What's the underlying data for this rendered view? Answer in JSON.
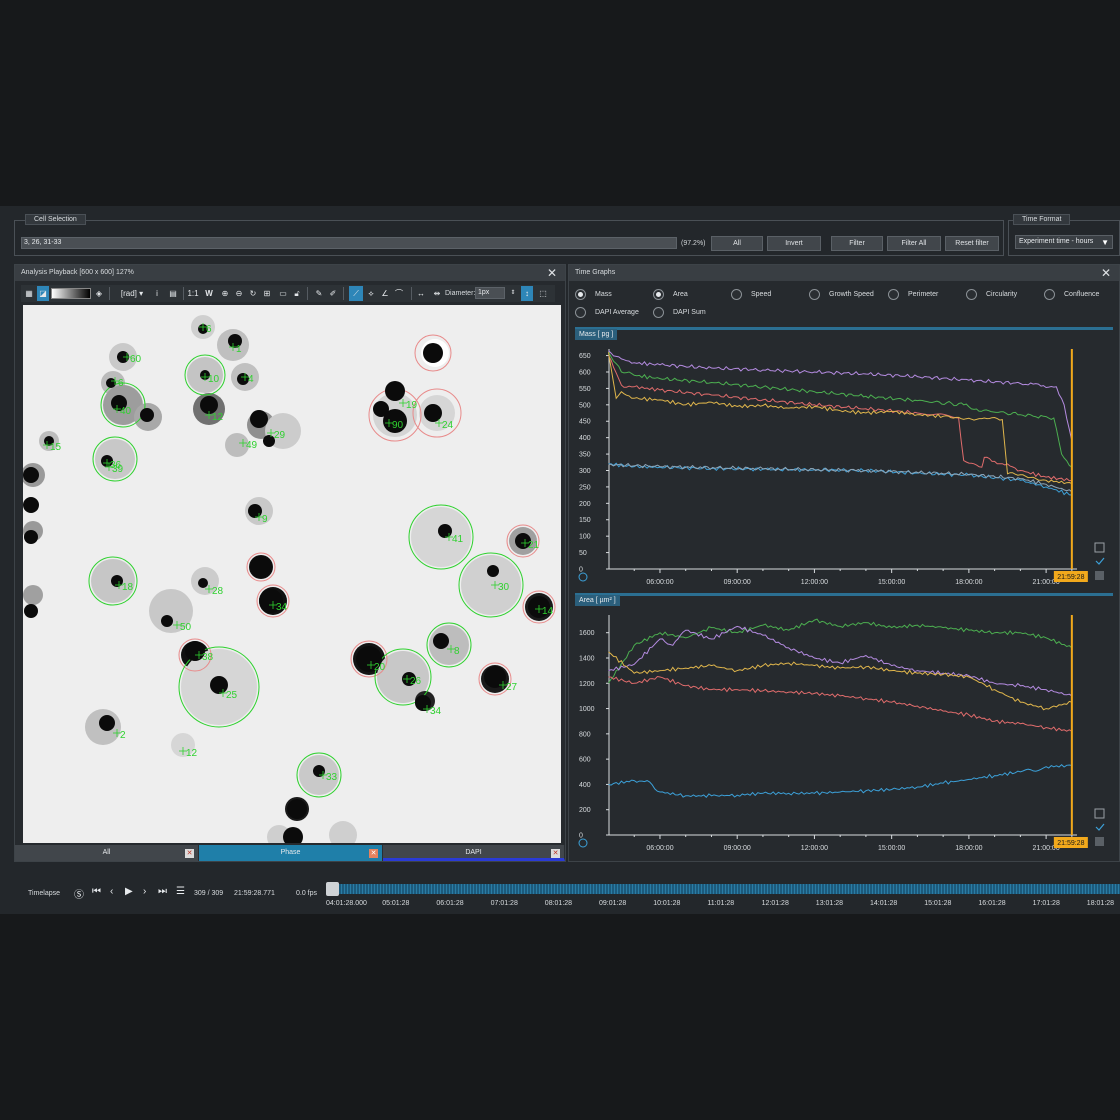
{
  "cell_selection": {
    "title": "Cell Selection",
    "value": "3, 26, 31-33",
    "percent": "(97.2%)",
    "buttons": [
      "All",
      "Invert",
      "Filter",
      "Filter All",
      "Reset filter"
    ]
  },
  "time_format": {
    "title": "Time Format",
    "selected": "Experiment time - hours"
  },
  "playback": {
    "title": "Analysis Playback [600 x 600] 127%",
    "toolbar": {
      "unit": "[rad]",
      "ratio": "1:1",
      "w": "W",
      "diameter_label": "Diameter:",
      "diameter_value": "1px"
    },
    "tabs": [
      "All",
      "Phase",
      "DAPI"
    ],
    "active_tab": "Phase",
    "cell_labels": [
      {
        "id": "6"
      },
      {
        "id": "1"
      },
      {
        "id": "60"
      },
      {
        "id": "6"
      },
      {
        "id": "10"
      },
      {
        "id": "4"
      },
      {
        "id": "40"
      },
      {
        "id": "29"
      },
      {
        "id": "12"
      },
      {
        "id": "19"
      },
      {
        "id": "90"
      },
      {
        "id": "24"
      },
      {
        "id": "39"
      },
      {
        "id": "49"
      },
      {
        "id": "15"
      },
      {
        "id": "36"
      },
      {
        "id": "9"
      },
      {
        "id": "41"
      },
      {
        "id": "21"
      },
      {
        "id": "30"
      },
      {
        "id": "28"
      },
      {
        "id": "18"
      },
      {
        "id": "34"
      },
      {
        "id": "14"
      },
      {
        "id": "50"
      },
      {
        "id": "38"
      },
      {
        "id": "20"
      },
      {
        "id": "26"
      },
      {
        "id": "8"
      },
      {
        "id": "27"
      },
      {
        "id": "25"
      },
      {
        "id": "34"
      },
      {
        "id": "2"
      },
      {
        "id": "12"
      },
      {
        "id": "33"
      }
    ]
  },
  "time_graphs": {
    "title": "Time Graphs",
    "measures": [
      {
        "label": "Mass",
        "selected": true
      },
      {
        "label": "Area",
        "selected": true
      },
      {
        "label": "Speed",
        "selected": false
      },
      {
        "label": "Growth Speed",
        "selected": false
      },
      {
        "label": "Perimeter",
        "selected": false
      },
      {
        "label": "Circularity",
        "selected": false
      },
      {
        "label": "Confluence",
        "selected": false
      },
      {
        "label": "DAPI Average",
        "selected": false
      },
      {
        "label": "DAPI Sum",
        "selected": false
      }
    ],
    "cursor_time": "21:59:28",
    "cursor_color": "#f2a91c"
  },
  "chart_data": [
    {
      "type": "line",
      "title": "Mass [ pg ]",
      "ylim": [
        0,
        670
      ],
      "y_ticks": [
        0,
        50,
        100,
        150,
        200,
        250,
        300,
        350,
        400,
        450,
        500,
        550,
        600,
        650
      ],
      "x_tick_labels": [
        "06:00:00",
        "09:00:00",
        "12:00:00",
        "15:00:00",
        "18:00:00",
        "21:00:00"
      ],
      "x_ticks_hours": [
        6,
        9,
        12,
        15,
        18,
        21
      ],
      "xlim_hours": [
        4.02,
        22.2
      ],
      "series": [
        {
          "color": "#b48be0",
          "x": [
            4.0,
            4.5,
            5,
            6,
            8,
            10,
            12,
            14,
            16,
            18,
            20,
            21.4,
            21.7,
            22.0
          ],
          "y": [
            665,
            640,
            628,
            622,
            612,
            606,
            600,
            594,
            586,
            575,
            565,
            555,
            500,
            390
          ]
        },
        {
          "color": "#4caf50",
          "x": [
            4.0,
            4.5,
            5,
            6,
            8,
            10,
            12,
            14,
            16,
            17.8,
            18.2,
            20,
            21.3,
            21.6,
            22.0
          ],
          "y": [
            660,
            600,
            590,
            580,
            568,
            554,
            540,
            526,
            513,
            500,
            486,
            470,
            460,
            350,
            310
          ]
        },
        {
          "color": "#e06c6c",
          "x": [
            4.0,
            4.5,
            5,
            6,
            8,
            10,
            12,
            14,
            16,
            17.6,
            17.8,
            18.5,
            18.6,
            20,
            21,
            22.0
          ],
          "y": [
            650,
            560,
            555,
            545,
            530,
            515,
            500,
            488,
            475,
            460,
            330,
            310,
            340,
            300,
            280,
            270
          ]
        },
        {
          "color": "#e0b64c",
          "x": [
            4.0,
            4.3,
            4.5,
            5,
            6,
            7,
            8,
            9,
            10,
            11,
            12,
            13,
            14,
            15,
            16,
            17,
            18.5,
            19.3,
            19.5,
            21,
            22.0
          ],
          "y": [
            660,
            520,
            540,
            520,
            515,
            500,
            508,
            495,
            498,
            490,
            495,
            482,
            475,
            480,
            470,
            465,
            458,
            455,
            290,
            270,
            260
          ]
        },
        {
          "color": "#3ca0d8",
          "x": [
            4.0,
            5,
            6,
            8,
            10,
            12,
            14,
            16,
            18,
            20,
            21,
            22.0
          ],
          "y": [
            320,
            312,
            310,
            306,
            304,
            302,
            300,
            292,
            286,
            270,
            250,
            225
          ]
        },
        {
          "color": "#8fa6b8",
          "x": [
            4.0,
            6,
            10,
            14,
            18,
            20,
            21,
            22.0
          ],
          "y": [
            318,
            312,
            305,
            300,
            288,
            275,
            258,
            235
          ]
        }
      ]
    },
    {
      "type": "line",
      "title": "Area [ µm² ]",
      "ylim": [
        0,
        1740
      ],
      "y_ticks": [
        0,
        200,
        400,
        600,
        800,
        1000,
        1200,
        1400,
        1600
      ],
      "x_tick_labels": [
        "06:00:00",
        "09:00:00",
        "12:00:00",
        "15:00:00",
        "18:00:00",
        "21:00:00"
      ],
      "x_ticks_hours": [
        6,
        9,
        12,
        15,
        18,
        21
      ],
      "xlim_hours": [
        4.02,
        22.2
      ],
      "series": [
        {
          "color": "#4caf50",
          "x": [
            4.0,
            5,
            6,
            7,
            8,
            9,
            10,
            11,
            12,
            13,
            14,
            15,
            16,
            17,
            18,
            19,
            20,
            21,
            22.0
          ],
          "y": [
            1200,
            1500,
            1600,
            1560,
            1640,
            1600,
            1660,
            1620,
            1700,
            1650,
            1680,
            1640,
            1660,
            1640,
            1620,
            1600,
            1600,
            1560,
            1480
          ]
        },
        {
          "color": "#b48be0",
          "x": [
            4.0,
            5,
            6,
            6.5,
            7,
            8,
            9,
            10,
            11,
            12,
            13,
            14,
            15,
            16,
            17,
            18,
            19,
            20,
            21,
            22.0
          ],
          "y": [
            1300,
            1350,
            1550,
            1500,
            1620,
            1550,
            1650,
            1580,
            1480,
            1400,
            1360,
            1420,
            1340,
            1300,
            1280,
            1260,
            1200,
            1180,
            1150,
            1100
          ]
        },
        {
          "color": "#e0b64c",
          "x": [
            4.0,
            5,
            6,
            7,
            8,
            9,
            10,
            11,
            12,
            13,
            14,
            15,
            16,
            17,
            18,
            19,
            20,
            21,
            22.0
          ],
          "y": [
            1450,
            1280,
            1300,
            1320,
            1340,
            1300,
            1340,
            1360,
            1340,
            1320,
            1330,
            1300,
            1280,
            1270,
            1250,
            1150,
            1050,
            1000,
            1050
          ]
        },
        {
          "color": "#e06c6c",
          "x": [
            4.0,
            5,
            6,
            7,
            8,
            9,
            10,
            11,
            12,
            13,
            14,
            15,
            16,
            17,
            18,
            19,
            20,
            21,
            22.0
          ],
          "y": [
            1250,
            1200,
            1250,
            1180,
            1150,
            1150,
            1140,
            1130,
            1120,
            1100,
            1080,
            1050,
            1020,
            980,
            950,
            900,
            880,
            850,
            820
          ]
        },
        {
          "color": "#3ca0d8",
          "x": [
            4.0,
            5,
            5.5,
            6,
            7,
            8,
            9,
            10,
            11,
            12,
            13,
            14,
            15,
            16,
            17,
            18,
            19,
            20,
            20.8,
            21,
            22.0
          ],
          "y": [
            400,
            430,
            430,
            340,
            310,
            310,
            315,
            330,
            330,
            330,
            340,
            350,
            360,
            380,
            410,
            440,
            470,
            500,
            520,
            540,
            550
          ]
        }
      ]
    }
  ],
  "transport": {
    "label": "Timelapse",
    "frame": "309 / 309",
    "time": "21:59:28.771",
    "fps": "0.0 fps",
    "ticks": [
      "04:01:28.000",
      "05:01:28",
      "06:01:28",
      "07:01:28",
      "08:01:28",
      "09:01:28",
      "10:01:28",
      "11:01:28",
      "12:01:28",
      "13:01:28",
      "14:01:28",
      "15:01:28",
      "16:01:28",
      "17:01:28",
      "18:01:28"
    ]
  }
}
